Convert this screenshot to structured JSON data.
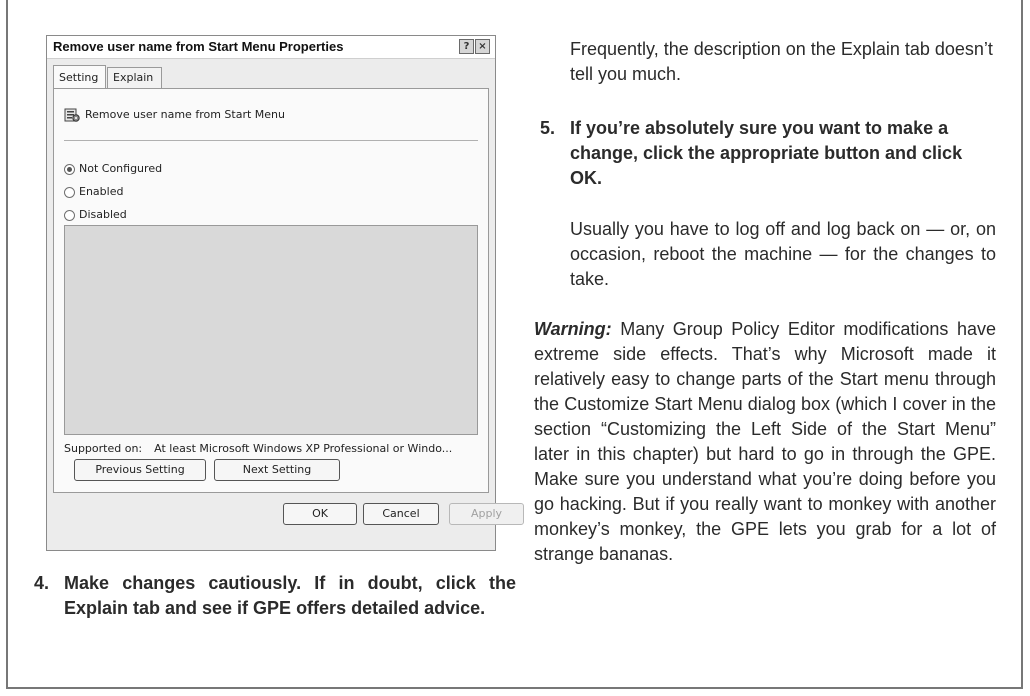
{
  "dialog": {
    "title": "Remove user name from Start Menu Properties",
    "help_glyph": "?",
    "close_glyph": "×",
    "tabs": [
      "Setting",
      "Explain"
    ],
    "policy_name": "Remove user name from Start Menu",
    "options": [
      {
        "label": "Not Configured",
        "checked": true
      },
      {
        "label": "Enabled",
        "checked": false
      },
      {
        "label": "Disabled",
        "checked": false
      }
    ],
    "supported_label": "Supported on:",
    "supported_value": "At least Microsoft Windows XP Professional or Windo...",
    "previous_button": "Previous Setting",
    "next_button": "Next Setting",
    "ok_button": "OK",
    "cancel_button": "Cancel",
    "apply_button": "Apply"
  },
  "text": {
    "paragraph_top": "Frequently, the description on the Explain tab doesn’t tell you much.",
    "step4_number": "4.",
    "step4": "Make changes cautiously. If in doubt, click the Explain tab and see if GPE offers detailed advice.",
    "step5_number": "5.",
    "step5": "If you’re absolutely sure you want to make a change, click the appropriate button and click OK.",
    "paragraph_usually": "Usually you have to log off and log back on — or, on occasion, reboot the machine — for the changes to take.",
    "warning_label": "Warning:",
    "warning_body": " Many Group Policy Editor modifications have extreme side effects. That’s why Microsoft made it relatively easy to change parts of the Start menu through the Customize Start Menu dialog box (which I cover in the section “Customizing the Left Side of the Start Menu” later in this chapter) but hard to go in through the GPE. Make sure you understand what you’re doing before you go hacking. But if you really want to monkey with another monkey’s monkey, the GPE lets you grab for a lot of strange bananas."
  }
}
